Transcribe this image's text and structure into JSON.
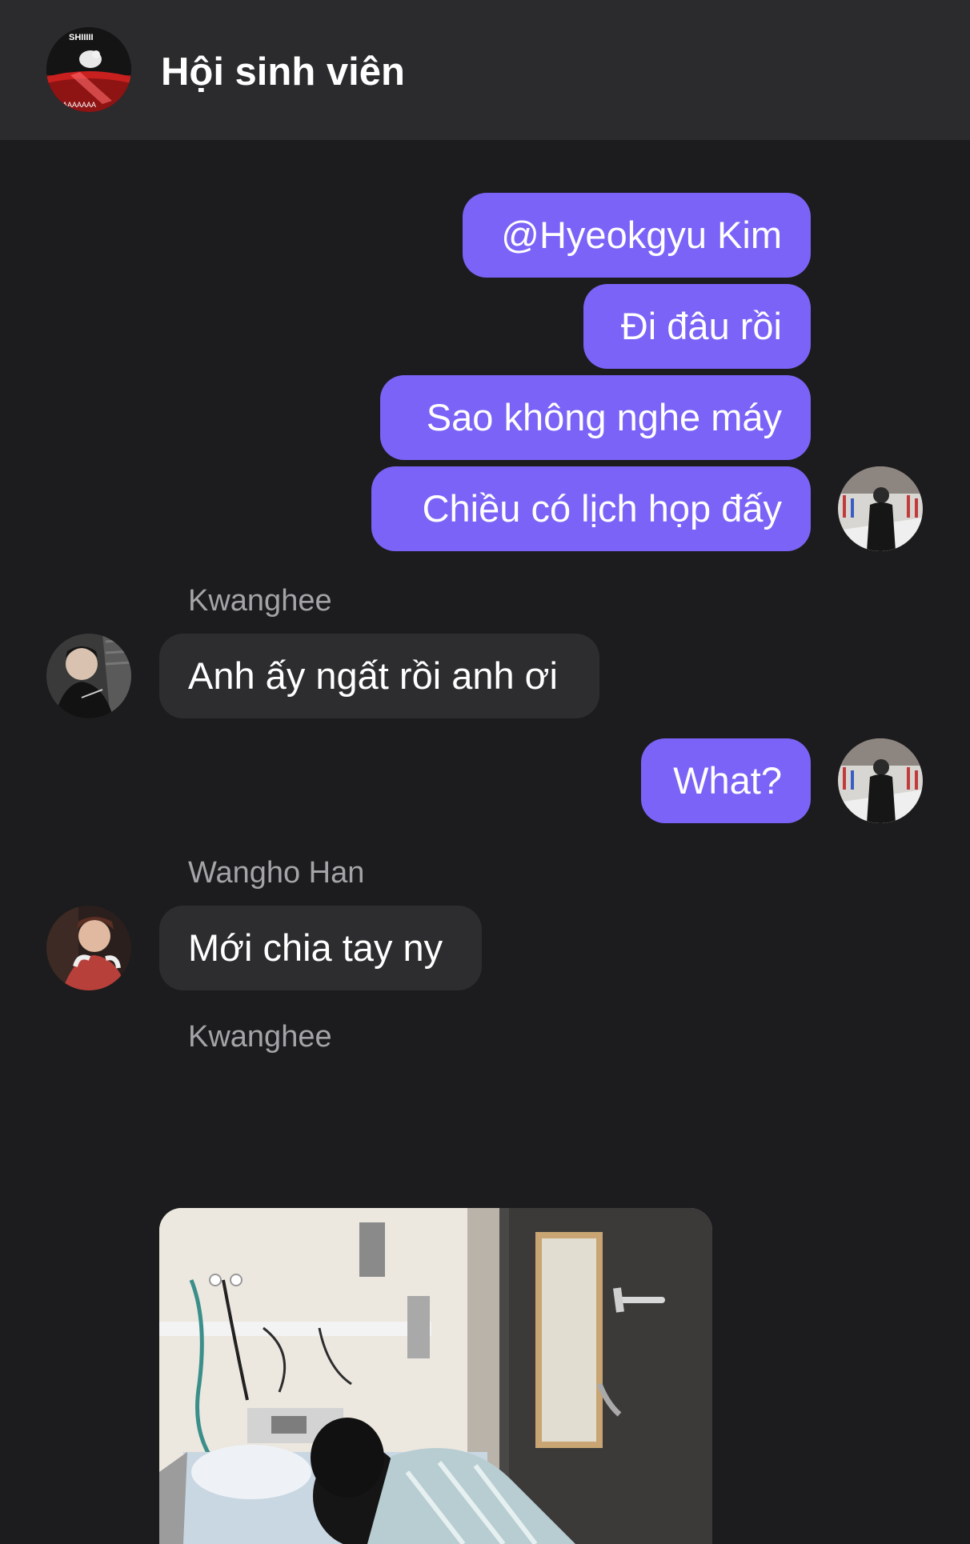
{
  "header": {
    "title": "Hội sinh viên",
    "avatar_overlay_text": "SHIIIII",
    "avatar_bottom_text": "AAAAAAAA"
  },
  "messages": [
    {
      "direction": "outgoing",
      "text": "@Hyeokgyu Kim"
    },
    {
      "direction": "outgoing",
      "text": "Đi đâu rồi"
    },
    {
      "direction": "outgoing",
      "text": "Sao không nghe máy"
    },
    {
      "direction": "outgoing",
      "text": "Chiều có lịch họp đấy"
    },
    {
      "direction": "incoming",
      "sender": "Kwanghee",
      "text": "Anh ấy ngất rồi anh ơi"
    },
    {
      "direction": "outgoing",
      "text": "What?"
    },
    {
      "direction": "incoming",
      "sender": "Wangho Han",
      "text": "Mới chia tay ny"
    },
    {
      "direction": "incoming",
      "sender": "Kwanghee",
      "type": "image"
    }
  ],
  "colors": {
    "background": "#1c1c1e",
    "header_bg": "#2b2b2e",
    "outgoing_bubble": "#7b63f7",
    "incoming_bubble": "#2d2d30",
    "sender_name": "#a4a4a8"
  }
}
